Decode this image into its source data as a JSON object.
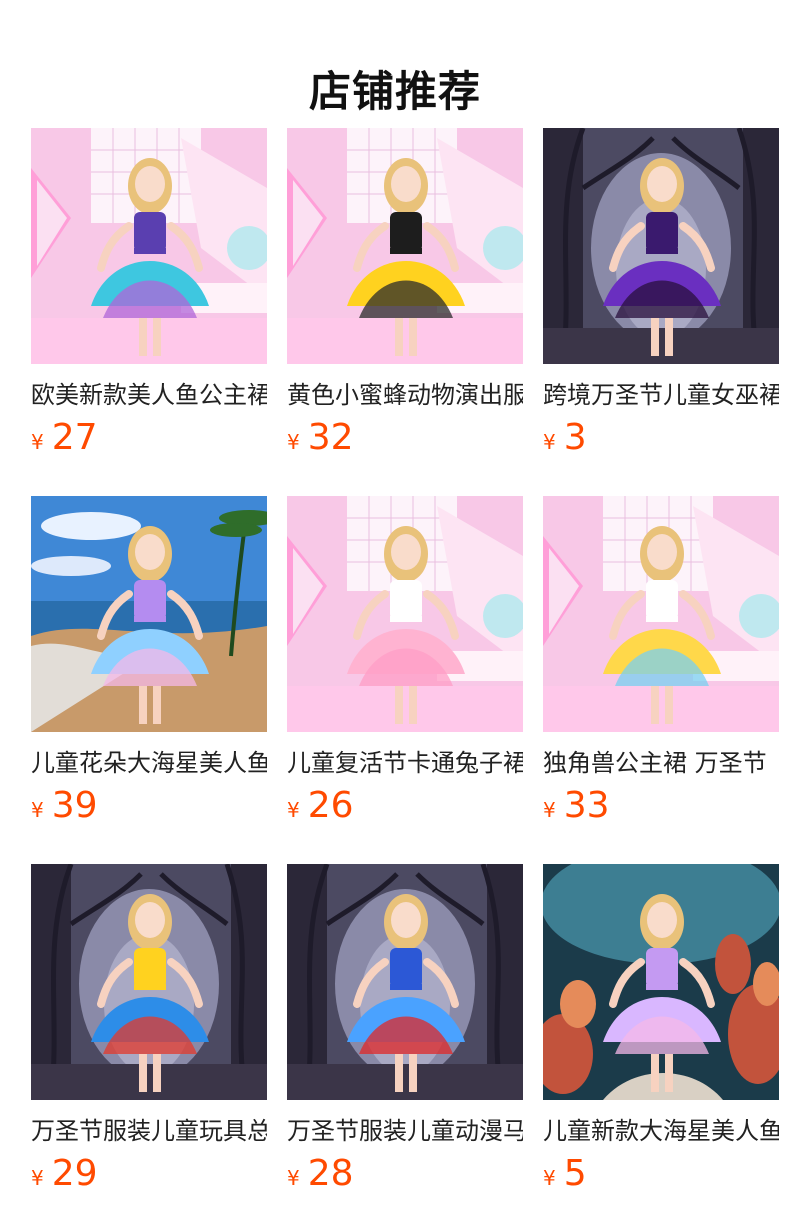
{
  "title": "店铺推荐",
  "currency_symbol": "¥",
  "accent_color": "#ff4a00",
  "products": [
    {
      "name": "欧美新款美人鱼公主裙",
      "price": "27",
      "bg": "pink-studio",
      "dress": [
        "#5a3fb0",
        "#3ec7e0",
        "#b066d8"
      ]
    },
    {
      "name": "黄色小蜜蜂动物演出服",
      "price": "32",
      "bg": "pink-studio",
      "dress": [
        "#1d1d1d",
        "#ffd21f",
        "#2b2b2b"
      ]
    },
    {
      "name": "跨境万圣节儿童女巫裙",
      "price": "3",
      "bg": "spooky-forest",
      "dress": [
        "#3a1a6e",
        "#6a2fc0",
        "#2a103e"
      ]
    },
    {
      "name": "儿童花朵大海星美人鱼裙",
      "price": "39",
      "bg": "beach",
      "dress": [
        "#b48cf0",
        "#8fd0ff",
        "#f4b8e8"
      ]
    },
    {
      "name": "儿童复活节卡通兔子裙",
      "price": "26",
      "bg": "pink-studio",
      "dress": [
        "#ffffff",
        "#ffb3d1",
        "#ff9ec5"
      ]
    },
    {
      "name": "独角兽公主裙 万圣节",
      "price": "33",
      "bg": "pink-studio",
      "dress": [
        "#ffffff",
        "#ffd84a",
        "#7ad0f0"
      ]
    },
    {
      "name": "万圣节服装儿童玩具总动员",
      "price": "29",
      "bg": "spooky-forest",
      "dress": [
        "#ffd21f",
        "#2d8de8",
        "#e33a2c"
      ]
    },
    {
      "name": "万圣节服装儿童动漫马里奥",
      "price": "28",
      "bg": "spooky-forest",
      "dress": [
        "#2c58d6",
        "#4aa2ff",
        "#e02828"
      ]
    },
    {
      "name": "儿童新款大海星美人鱼裙",
      "price": "5",
      "bg": "underwater",
      "dress": [
        "#c49af2",
        "#d9b7ff",
        "#f4b8e8"
      ]
    }
  ]
}
